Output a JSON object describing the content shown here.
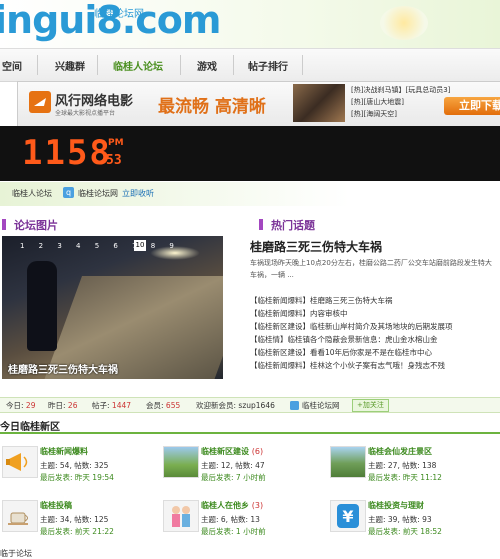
{
  "header": {
    "logo": "ingui8.com",
    "subtitle": "临桂论坛网"
  },
  "nav": {
    "items": [
      "空间",
      "兴趣群",
      "临桂人论坛",
      "游戏",
      "帖子排行"
    ],
    "active_index": 2
  },
  "ad": {
    "brand": "风行网络电影",
    "sub": "全球最大影视点播平台",
    "slogan": "最流畅 高清晰",
    "links": [
      "[热]决战刹马镇】[玩具总动员3]",
      "[热][唐山大地震]",
      "[热][海阔天空]"
    ],
    "button": "立即下载"
  },
  "clock": {
    "time": "1158",
    "ampm": "PM",
    "seconds": "53"
  },
  "breadcrumb": {
    "home": "临桂人论坛",
    "site": "临桂论坛网",
    "action": "立即收听"
  },
  "forum_pics": {
    "heading": "论坛图片",
    "numbers": "1 2 3 4 5 6 7 8 9",
    "current": "10",
    "caption": "桂磨路三死三伤特大车祸"
  },
  "hot": {
    "heading": "热门话题",
    "title": "桂磨路三死三伤特大车祸",
    "desc": "车祸现场昨天晚上10点20分左右，桂磨公路二药厂公交车站磨前路段发生特大车祸，一辆 ...",
    "items": [
      "【临桂新闻爆料】桂磨路三死三伤特大车祸",
      "【临桂新闻爆料】内容审核中",
      "【临桂新区建设】临桂新山岸村简介及其场地块的后期发展项",
      "【临桂情】临桂镇各个隐蔽会景新信息：虎山金水榕山金",
      "【临桂新区建设】看看10年后你家是不是在临桂市中心",
      "【临桂新闻爆料】桂林这个小伙子案有志气哦！身残志不残"
    ]
  },
  "stats": {
    "today_label": "今日:",
    "today": "29",
    "yesterday_label": "昨日:",
    "yesterday": "26",
    "posts_label": "帖子:",
    "posts": "1447",
    "members_label": "会员:",
    "members": "655",
    "welcome_label": "欢迎新会员:",
    "welcome": "szup1646",
    "site": "临桂论坛网",
    "follow": "+加关注"
  },
  "today_section": {
    "title": "今日临桂新区"
  },
  "forums": [
    {
      "name": "临桂新闻爆料",
      "new": "",
      "stat": "主题: 54, 帖数: 325",
      "last": "最后发表: 昨天 19:54"
    },
    {
      "name": "临桂新区建设",
      "new": "(6)",
      "stat": "主题: 12, 帖数: 47",
      "last": "最后发表: 7 小时前"
    },
    {
      "name": "临桂会仙发庄景区",
      "new": "",
      "stat": "主题: 27, 帖数: 138",
      "last": "最后发表: 昨天 11:12"
    },
    {
      "name": "临桂投稿",
      "new": "",
      "stat": "主题: 34, 帖数: 125",
      "last": "最后发表: 前天 21:22"
    },
    {
      "name": "临桂人在他乡",
      "new": "(3)",
      "stat": "主题: 6, 帖数: 13",
      "last": "最后发表: 1 小时前"
    },
    {
      "name": "临桂投资与理财",
      "new": "",
      "stat": "主题: 39, 帖数: 93",
      "last": "最后发表: 前天 18:52"
    }
  ],
  "bottom": {
    "text": "临于论坛"
  }
}
